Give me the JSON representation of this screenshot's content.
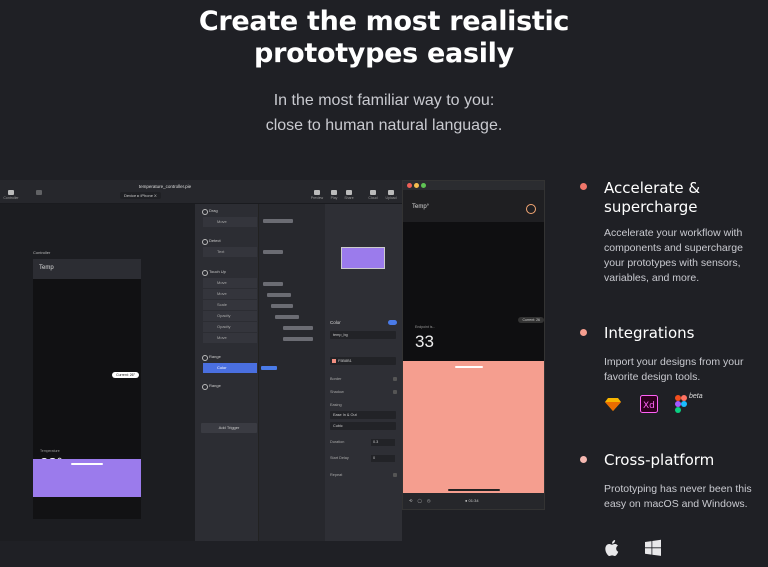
{
  "hero": {
    "title_line1": "Create the most realistic",
    "title_line2": "prototypes easily",
    "subtitle_line1": "In the most familiar way to you:",
    "subtitle_line2": "close to human natural language."
  },
  "app": {
    "document_title": "temperature_controller.pie",
    "toolbar": {
      "controller": "Controller",
      "device_label": "Device",
      "device_value": "iPhone X",
      "preview": "Preview",
      "play": "Play",
      "share": "Share",
      "cloud": "Cloud",
      "upload": "Upload"
    },
    "canvas": {
      "label": "Controller",
      "header": "Temp",
      "tooltip": "Current: 26°",
      "temp_label": "Temperature",
      "temp_value": "23°"
    },
    "triggers": [
      {
        "name": "Drag",
        "rows": [
          "Move"
        ]
      },
      {
        "name": "Detect",
        "rows": [
          "Text"
        ]
      },
      {
        "name": "Touch Up",
        "rows": [
          "Move",
          "Move",
          "Scale",
          "Opacity",
          "Opacity",
          "Move"
        ]
      },
      {
        "name": "Range",
        "rows": [
          "Color"
        ]
      },
      {
        "name": "Range",
        "rows": []
      }
    ],
    "add_trigger": "Add Trigger",
    "properties": {
      "color_header": "Color",
      "layer": "temp_bg",
      "hex": "F5B8B1",
      "border": "Border",
      "shadow": "Shadow",
      "easing_label": "Easing",
      "easing_value": "Ease In & Out",
      "curve_value": "Cubic",
      "duration_label": "Duration",
      "duration_value": "0.3",
      "start_delay_label": "Start Delay",
      "start_delay_value": "0",
      "repeat_label": "Repeat"
    }
  },
  "preview": {
    "header": "Temp°",
    "tooltip": "Current: 26",
    "small_label": "Endpoint is...",
    "value": "33",
    "time": "01:34",
    "colors": {
      "salmon": "#f59e8f",
      "purple": "#9b7bec",
      "ring": "#f4a774"
    }
  },
  "features": [
    {
      "title_line1": "Accelerate &",
      "title_line2": "supercharge",
      "desc": "Accelerate your workflow with components and supercharge your prototypes with sensors, variables, and more.",
      "bullet_color": "#f0766a"
    },
    {
      "title_line1": "Integrations",
      "title_line2": "",
      "desc": "Import your designs from your favorite design tools.",
      "bullet_color": "#f59e8f",
      "icons": [
        "sketch-icon",
        "xd-icon",
        "figma-icon"
      ],
      "beta_label": "beta"
    },
    {
      "title_line1": "Cross-platform",
      "title_line2": "",
      "desc": "Prototyping has never been this easy on macOS and Windows.",
      "bullet_color": "#f5b8b1",
      "icons": [
        "apple-icon",
        "windows-icon"
      ]
    }
  ]
}
